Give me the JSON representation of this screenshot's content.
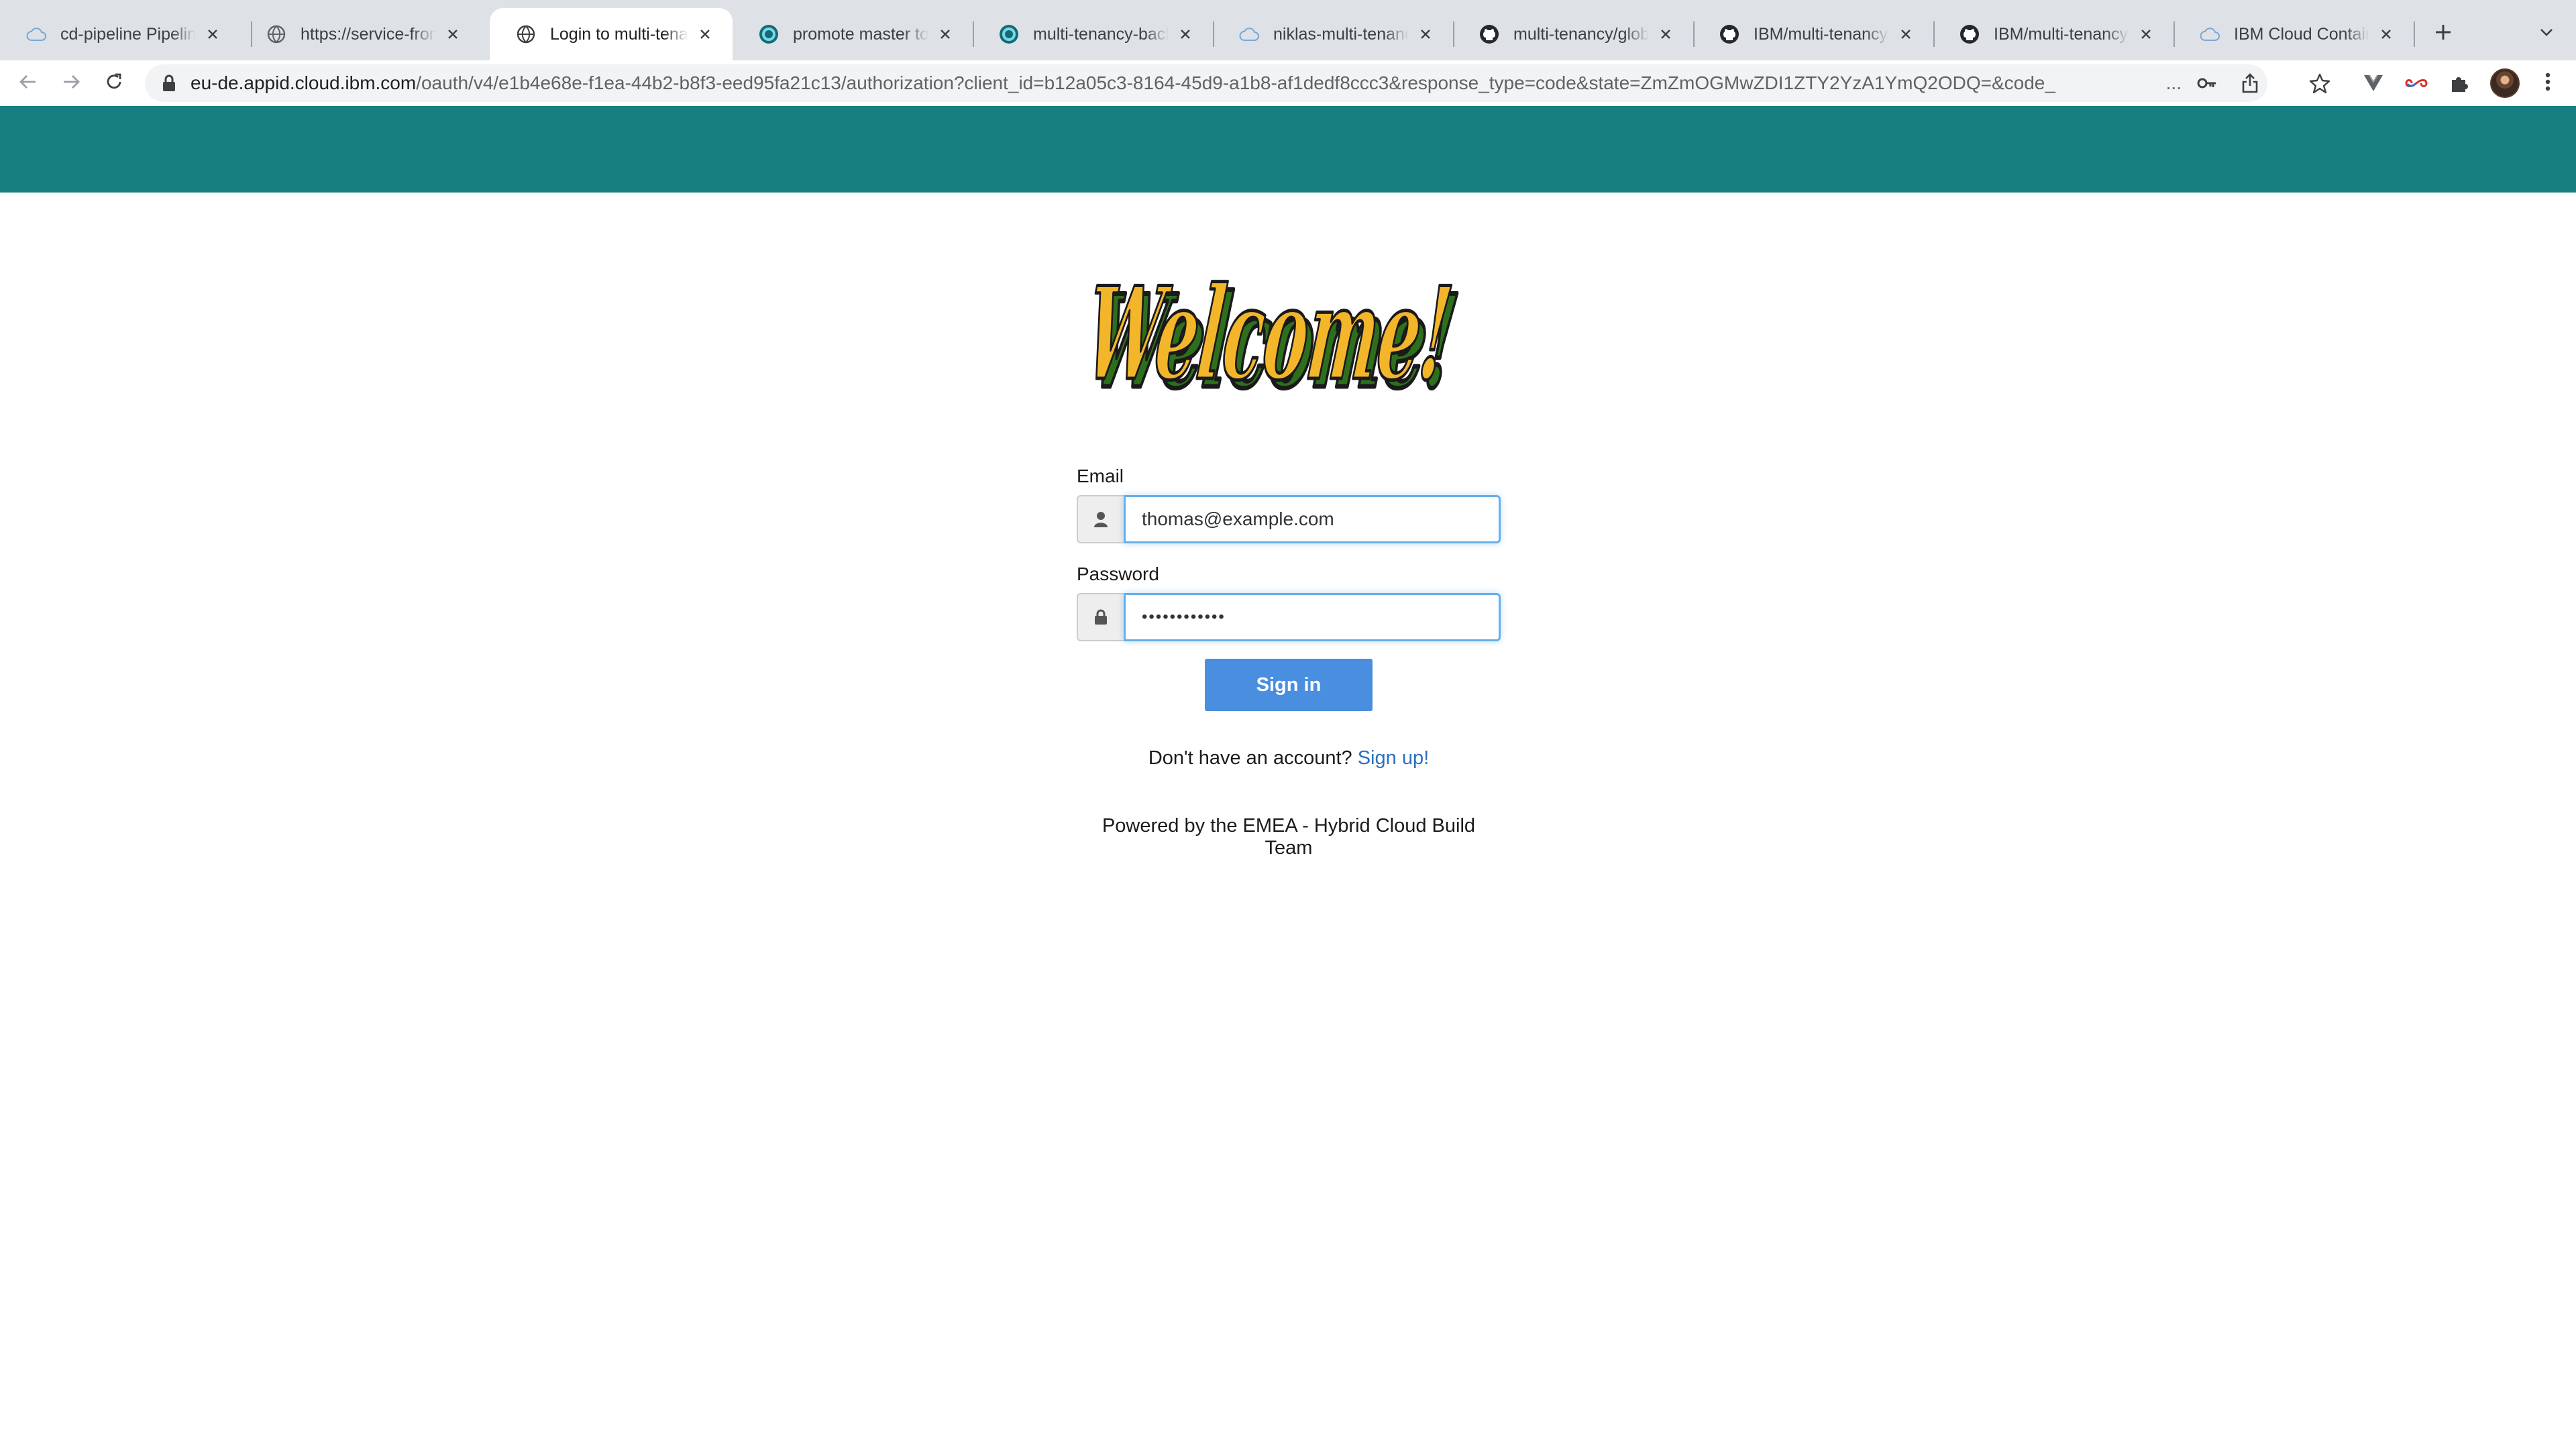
{
  "browser": {
    "tabs": [
      {
        "title": "cd-pipeline Pipelines",
        "icon": "cloud-icon",
        "active": false
      },
      {
        "title": "https://service-frontend",
        "icon": "globe-icon",
        "active": false
      },
      {
        "title": "Login to multi-tenancy",
        "icon": "globe-icon",
        "active": true
      },
      {
        "title": "promote master to test",
        "icon": "toolchain-icon",
        "active": false
      },
      {
        "title": "multi-tenancy-backend",
        "icon": "toolchain-icon",
        "active": false
      },
      {
        "title": "niklas-multi-tenancy",
        "icon": "cloud-icon",
        "active": false
      },
      {
        "title": "multi-tenancy/global",
        "icon": "github-icon",
        "active": false
      },
      {
        "title": "IBM/multi-tenancy-backend",
        "icon": "github-icon",
        "active": false
      },
      {
        "title": "IBM/multi-tenancy-frontend",
        "icon": "github-icon",
        "active": false
      },
      {
        "title": "IBM Cloud Containers",
        "icon": "cloud-icon",
        "active": false
      }
    ],
    "address": {
      "host": "eu-de.appid.cloud.ibm.com",
      "path": "/oauth/v4/e1b4e68e-f1ea-44b2-b8f3-eed95fa21c13/authorization?client_id=b12a05c3-8164-45d9-a1b8-af1dedf8ccc3&response_type=code&state=ZmZmOGMwZDI1ZTY2YzA1YmQ2ODQ=&code_",
      "ellipsis": "..."
    }
  },
  "page": {
    "header_color": "#177f80",
    "welcome_text": "Welcome!",
    "email_label": "Email",
    "email_value": "thomas@example.com",
    "password_label": "Password",
    "password_value": "••••••••••••",
    "signin_label": "Sign in",
    "signup_prompt": "Don't have an account?",
    "signup_link": "Sign up!",
    "powered_by": "Powered by the EMEA - Hybrid Cloud Build Team",
    "accent_color": "#4a8fdf"
  }
}
